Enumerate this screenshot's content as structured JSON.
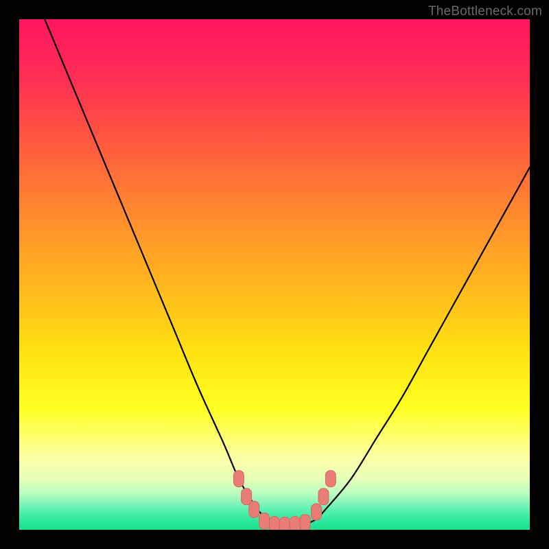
{
  "watermark": {
    "text": "TheBottleneck.com"
  },
  "colors": {
    "curve_stroke": "#000000",
    "marker_fill": "#e77d74",
    "marker_stroke": "#d66a61"
  },
  "chart_data": {
    "type": "line",
    "title": "",
    "xlabel": "",
    "ylabel": "",
    "xlim": [
      0,
      100
    ],
    "ylim": [
      0,
      100
    ],
    "grid": false,
    "legend": false,
    "series": [
      {
        "name": "bottleneck-curve",
        "x": [
          5,
          10,
          15,
          20,
          25,
          30,
          35,
          40,
          43,
          46,
          48,
          50,
          52,
          54,
          56,
          58,
          60,
          65,
          70,
          75,
          80,
          85,
          90,
          95,
          100
        ],
        "y": [
          100,
          88,
          76,
          64,
          52,
          40,
          28,
          17,
          10,
          5,
          2.5,
          1.3,
          0.8,
          0.8,
          1.1,
          2,
          4,
          10,
          18,
          26,
          35,
          44,
          53,
          62,
          71
        ]
      }
    ],
    "markers": {
      "name": "low-bottleneck-highlight",
      "points": [
        {
          "x": 43.0,
          "y": 10.0
        },
        {
          "x": 44.5,
          "y": 6.5
        },
        {
          "x": 46.0,
          "y": 4.0
        },
        {
          "x": 48.0,
          "y": 1.7
        },
        {
          "x": 50.0,
          "y": 1.0
        },
        {
          "x": 52.0,
          "y": 0.9
        },
        {
          "x": 54.0,
          "y": 1.0
        },
        {
          "x": 56.0,
          "y": 1.4
        },
        {
          "x": 58.2,
          "y": 3.5
        },
        {
          "x": 59.6,
          "y": 6.5
        },
        {
          "x": 61.0,
          "y": 10.0
        }
      ]
    }
  }
}
